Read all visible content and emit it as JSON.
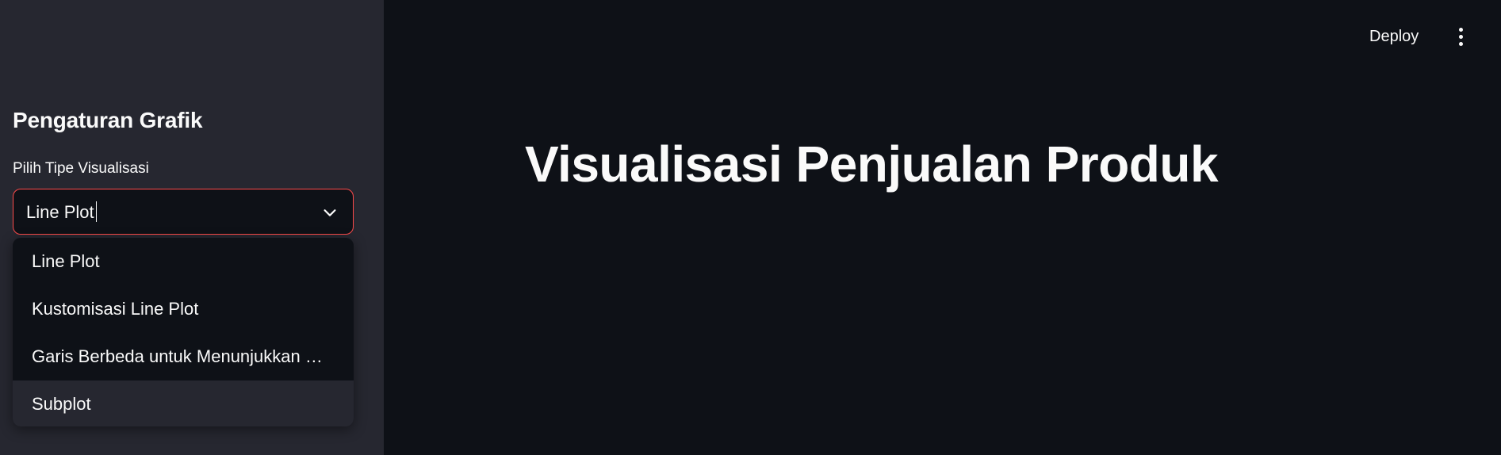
{
  "header": {
    "deploy_label": "Deploy",
    "menu_icon": "vertical-dots-icon"
  },
  "sidebar": {
    "heading": "Pengaturan Grafik",
    "select": {
      "label": "Pilih Tipe Visualisasi",
      "value": "Line Plot",
      "chevron_icon": "chevron-down-icon",
      "options": [
        "Line Plot",
        "Kustomisasi Line Plot",
        "Garis Berbeda untuk Menunjukkan …",
        "Subplot"
      ],
      "highlighted_option": "Subplot"
    }
  },
  "main": {
    "title": "Visualisasi Penjualan Produk"
  },
  "colors": {
    "sidebar_bg": "#262730",
    "main_bg": "#0e1117",
    "accent": "#ff4b4b",
    "text": "#fafafa"
  }
}
